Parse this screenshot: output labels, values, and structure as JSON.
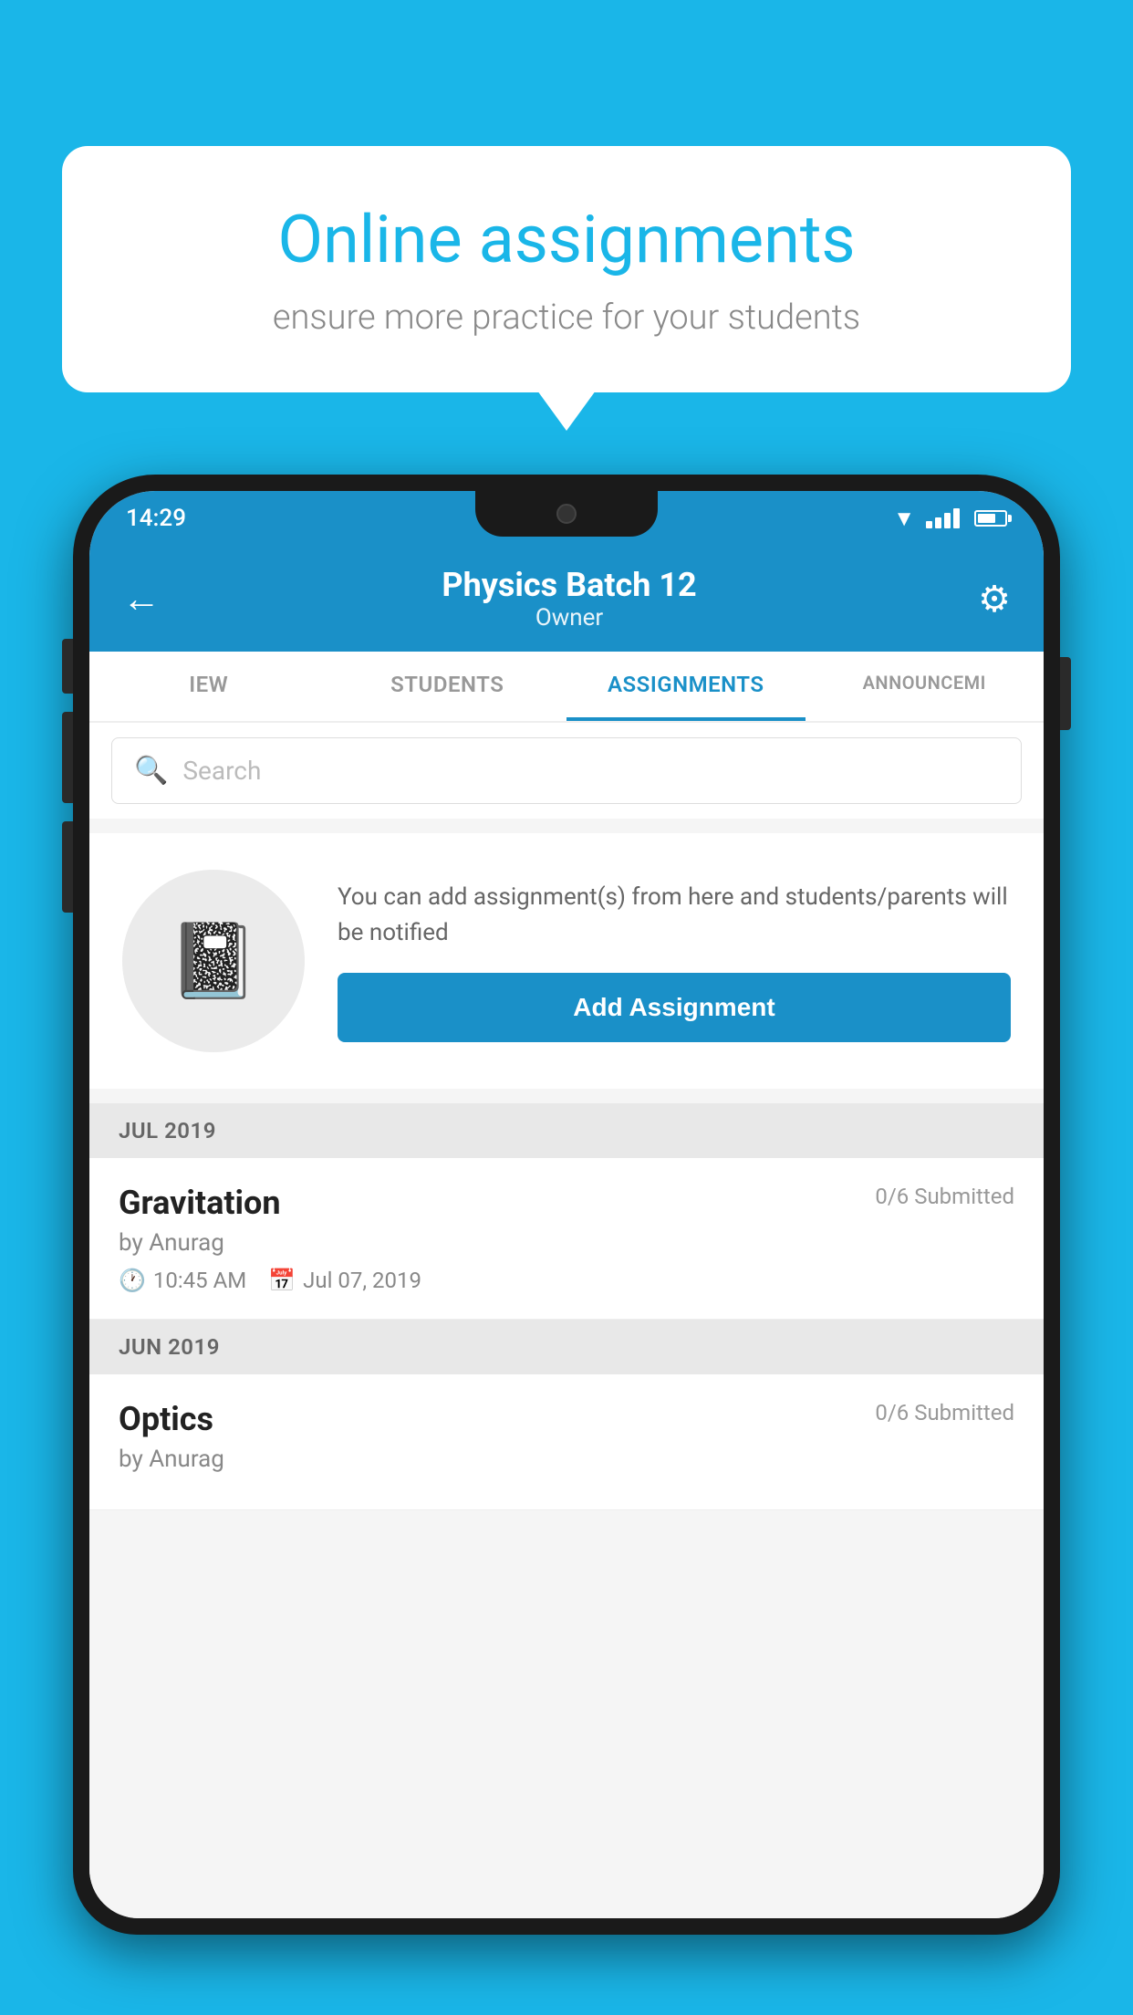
{
  "background_color": "#1ab6e8",
  "speech_bubble": {
    "title": "Online assignments",
    "subtitle": "ensure more practice for your students"
  },
  "phone": {
    "status_bar": {
      "time": "14:29"
    },
    "header": {
      "title": "Physics Batch 12",
      "subtitle": "Owner",
      "back_label": "←",
      "gear_label": "⚙"
    },
    "tabs": [
      {
        "label": "IEW",
        "active": false
      },
      {
        "label": "STUDENTS",
        "active": false
      },
      {
        "label": "ASSIGNMENTS",
        "active": true
      },
      {
        "label": "ANNOUNCEMENTS",
        "active": false
      }
    ],
    "search": {
      "placeholder": "Search"
    },
    "empty_state": {
      "description": "You can add assignment(s) from here and students/parents will be notified",
      "button_label": "Add Assignment"
    },
    "sections": [
      {
        "label": "JUL 2019",
        "assignments": [
          {
            "title": "Gravitation",
            "submitted": "0/6 Submitted",
            "by": "by Anurag",
            "time": "10:45 AM",
            "date": "Jul 07, 2019"
          }
        ]
      },
      {
        "label": "JUN 2019",
        "assignments": [
          {
            "title": "Optics",
            "submitted": "0/6 Submitted",
            "by": "by Anurag",
            "time": "",
            "date": ""
          }
        ]
      }
    ]
  }
}
